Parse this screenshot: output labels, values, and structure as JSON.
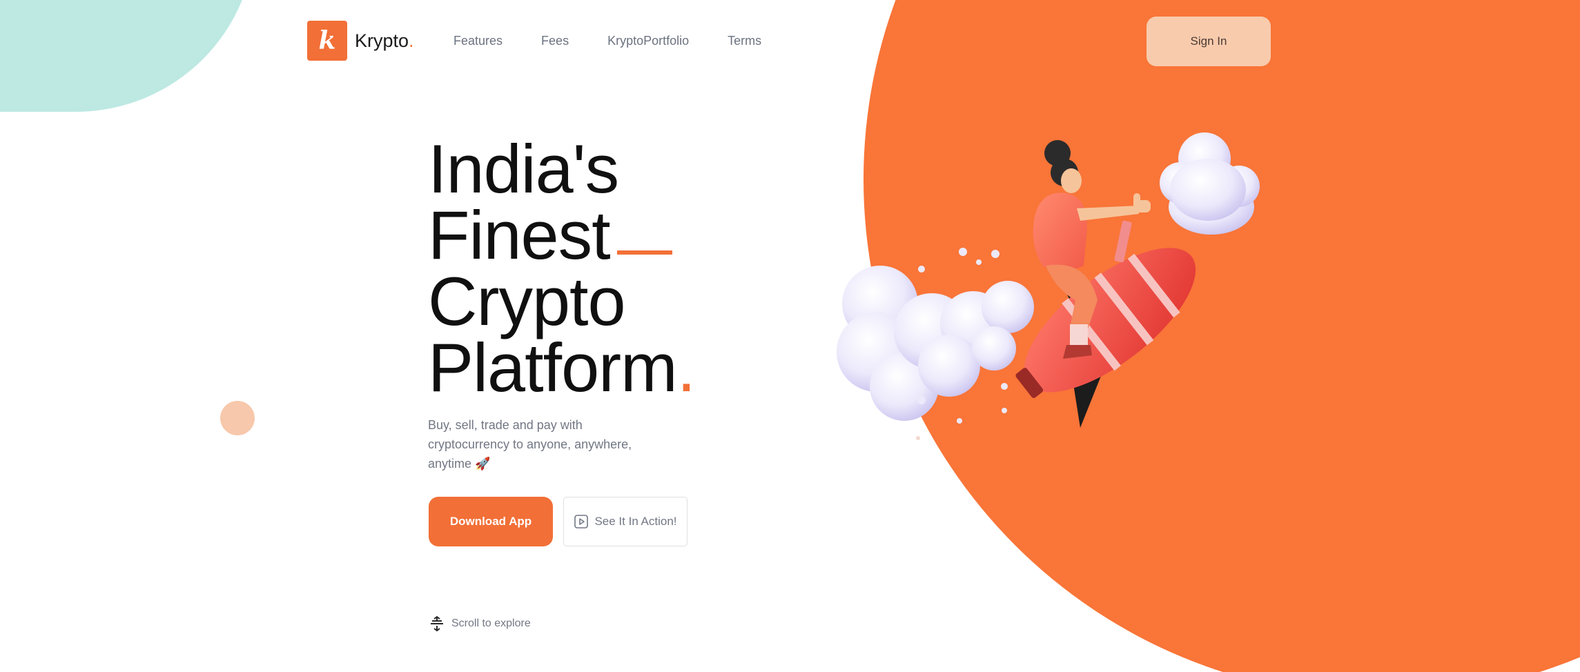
{
  "brand": {
    "logo_letter": "k",
    "name": "Krypto",
    "name_dot": ".",
    "accent_color": "#f26f37",
    "circle_color": "#f97538",
    "teal_color": "#bde9e2"
  },
  "nav": {
    "items": [
      "Features",
      "Fees",
      "KryptoPortfolio",
      "Terms"
    ]
  },
  "header": {
    "sign_in_label": "Sign In"
  },
  "hero": {
    "headline_lines": [
      "India's",
      "Finest",
      "Crypto",
      "Platform"
    ],
    "headline_dot": ".",
    "subtitle": "Buy, sell, trade and pay with cryptocurrency to anyone, anywhere, anytime 🚀",
    "download_label": "Download App",
    "action_label": "See It In Action!",
    "action_icon": "play-square-icon"
  },
  "scroll": {
    "label": "Scroll to explore",
    "icon": "scroll-arrows-icon"
  },
  "illustration": {
    "subject": "rocket-rider-icon"
  }
}
